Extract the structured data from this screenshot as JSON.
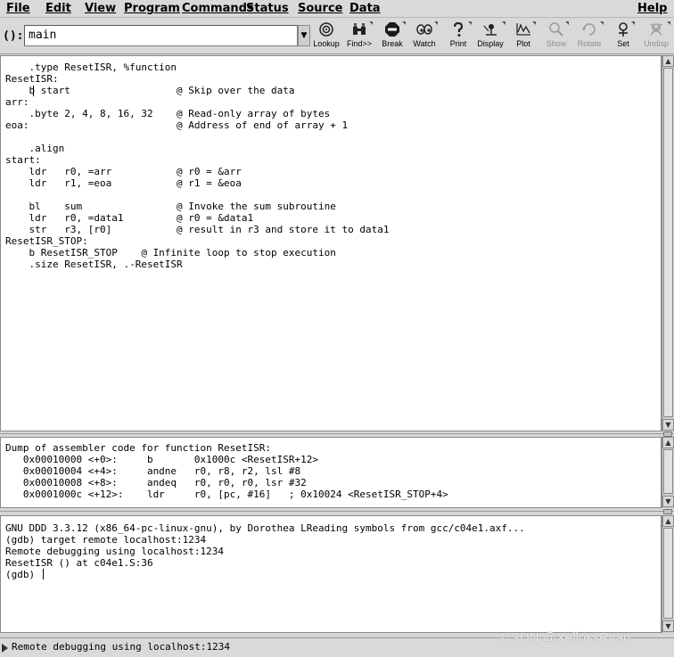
{
  "menubar": {
    "items": [
      "File",
      "Edit",
      "View",
      "Program",
      "Commands",
      "Status",
      "Source",
      "Data"
    ],
    "help": "Help"
  },
  "toolbar": {
    "arg_label": "():",
    "arg_value": "main",
    "buttons": [
      "Lookup",
      "Find>>",
      "Break",
      "Watch",
      "Print",
      "Display",
      "Plot",
      "Show",
      "Rotate",
      "Set",
      "Undisp"
    ]
  },
  "source": {
    "lines": [
      "    .type ResetISR, %function",
      "ResetISR:",
      "    b start                  @ Skip over the data",
      "arr:",
      "    .byte 2, 4, 8, 16, 32    @ Read-only array of bytes",
      "eoa:                         @ Address of end of array + 1",
      "",
      "    .align",
      "start:",
      "    ldr   r0, =arr           @ r0 = &arr",
      "    ldr   r1, =eoa           @ r1 = &eoa",
      "",
      "    bl    sum                @ Invoke the sum subroutine",
      "    ldr   r0, =data1         @ r0 = &data1",
      "    str   r3, [r0]           @ result in r3 and store it to data1",
      "ResetISR_STOP:",
      "    b ResetISR_STOP    @ Infinite loop to stop execution",
      "    .size ResetISR, .-ResetISR"
    ]
  },
  "assembler": {
    "lines": [
      "Dump of assembler code for function ResetISR:",
      "   0x00010000 <+0>:     b       0x1000c <ResetISR+12>",
      "   0x00010004 <+4>:     andne   r0, r8, r2, lsl #8",
      "   0x00010008 <+8>:     andeq   r0, r0, r0, lsr #32",
      "   0x0001000c <+12>:    ldr     r0, [pc, #16]   ; 0x10024 <ResetISR_STOP+4>"
    ]
  },
  "console": {
    "lines": [
      "GNU DDD 3.3.12 (x86_64-pc-linux-gnu), by Dorothea LReading symbols from gcc/c04e1.axf...",
      "(gdb) target remote localhost:1234",
      "Remote debugging using localhost:1234",
      "ResetISR () at c04e1.S:36",
      "(gdb) "
    ]
  },
  "status": {
    "text": "Remote debugging using localhost:1234"
  },
  "watermark": "CSDN @XellossRyan"
}
